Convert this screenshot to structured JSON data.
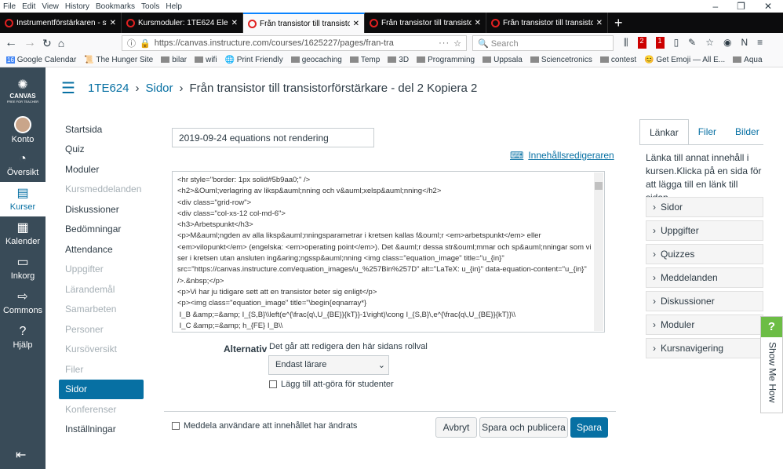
{
  "browser": {
    "menu": [
      "File",
      "Edit",
      "View",
      "History",
      "Bookmarks",
      "Tools",
      "Help"
    ],
    "tabs": [
      "Instrumentförstärkaren - steg f",
      "Kursmoduler: 1TE624 Elektroni",
      "Från transistor till transistorförs",
      "Från transistor till transistorförs",
      "Från transistor till transistorförs"
    ],
    "url": "https://canvas.instructure.com/courses/1625227/pages/fran-tra",
    "search_placeholder": "Search",
    "badges": [
      "2",
      "1"
    ],
    "bookmarks": [
      "Google Calendar",
      "The Hunger Site",
      "bilar",
      "wifi",
      "Print Friendly",
      "geocaching",
      "Temp",
      "3D",
      "Programming",
      "Uppsala",
      "Sciencetronics",
      "contest",
      "Get Emoji — All E...",
      "Aqua"
    ]
  },
  "global_nav": {
    "logo": "CANVAS",
    "logo_sub": "FREE FOR TEACHER",
    "items": [
      {
        "label": "Konto",
        "icon": "avatar"
      },
      {
        "label": "Översikt",
        "icon": "dashboard-icon"
      },
      {
        "label": "Kurser",
        "icon": "book-icon"
      },
      {
        "label": "Kalender",
        "icon": "calendar-icon"
      },
      {
        "label": "Inkorg",
        "icon": "inbox-icon"
      },
      {
        "label": "Commons",
        "icon": "commons-icon"
      },
      {
        "label": "Hjälp",
        "icon": "help-icon"
      }
    ]
  },
  "breadcrumb": {
    "course": "1TE624",
    "section": "Sidor",
    "page": "Från transistor till transistorförstärkare - del 2 Kopiera 2"
  },
  "course_nav": [
    {
      "label": "Startsida"
    },
    {
      "label": "Quiz"
    },
    {
      "label": "Moduler"
    },
    {
      "label": "Kursmeddelanden",
      "disabled": true
    },
    {
      "label": "Diskussioner"
    },
    {
      "label": "Bedömningar"
    },
    {
      "label": "Attendance"
    },
    {
      "label": "Uppgifter",
      "disabled": true
    },
    {
      "label": "Lärandemål",
      "disabled": true
    },
    {
      "label": "Samarbeten",
      "disabled": true
    },
    {
      "label": "Personer",
      "disabled": true
    },
    {
      "label": "Kursöversikt",
      "disabled": true
    },
    {
      "label": "Filer",
      "disabled": true
    },
    {
      "label": "Sidor",
      "active": true
    },
    {
      "label": "Konferenser",
      "disabled": true
    },
    {
      "label": "Inställningar"
    }
  ],
  "editor": {
    "title_value": "2019-09-24 equations not rendering",
    "editor_link": "Innehållsredigeraren",
    "html": "<hr style=\"border: 1px solid#5b9aa0;\" />\n<h2>&Ouml;verlagring av liksp&auml;nning och v&auml;xelsp&auml;nning</h2>\n<div class=\"grid-row\">\n<div class=\"col-xs-12 col-md-6\">\n<h3>Arbetspunkt</h3>\n<p>M&auml;ngden av alla liksp&auml;nningsparametrar i kretsen kallas f&ouml;r <em>arbetspunkt</em> eller <em>vilopunkt</em> (engelska: <em>operating point</em>). Det &auml;r dessa str&ouml;mmar och sp&auml;nningar som vi ser i kretsen utan ansluten ing&aring;ngssp&auml;nning <img class=\"equation_image\" title=\"u_{in}\" src=\"https://canvas.instructure.com/equation_images/u_%257Bin%257D\" alt=\"LaTeX: u_{in}\" data-equation-content=\"u_{in}\" />.&nbsp;</p>\n<p>Vi har ju tidigare sett att en transistor beter sig enligt</p>\n<p><img class=\"equation_image\" title=\"\\begin{eqnarray*}\n I_B &amp;=&amp; I_{S,B}\\\\left(e^{\\frac{q\\,U_{BE}}{kT}}-1\\right)\\cong I_{S,B}\\,e^{\\frac{q\\,U_{BE}}{kT}}\\\\\n I_C &amp;=&amp; h_{FE} I_B\\\\",
    "options_label": "Alternativ",
    "options_desc": "Det går att redigera den här sidans rollval",
    "role_value": "Endast lärare",
    "todo_label": "Lägg till att-göra för studenter",
    "notify_label": "Meddela användare att innehållet har ändrats",
    "cancel": "Avbryt",
    "save_publish": "Spara och publicera",
    "save": "Spara"
  },
  "sidebar": {
    "tabs": [
      "Länkar",
      "Filer",
      "Bilder"
    ],
    "desc": "Länka till annat innehåll i kursen.Klicka på en sida för att lägga till en länk till sidan.",
    "items": [
      "Sidor",
      "Uppgifter",
      "Quizzes",
      "Meddelanden",
      "Diskussioner",
      "Moduler",
      "Kursnavigering"
    ]
  },
  "show_me_how": {
    "icon": "?",
    "label": "Show Me How"
  },
  "colors": {
    "accent": "#0770a3",
    "nav": "#394b58",
    "save": "#0770a3"
  }
}
